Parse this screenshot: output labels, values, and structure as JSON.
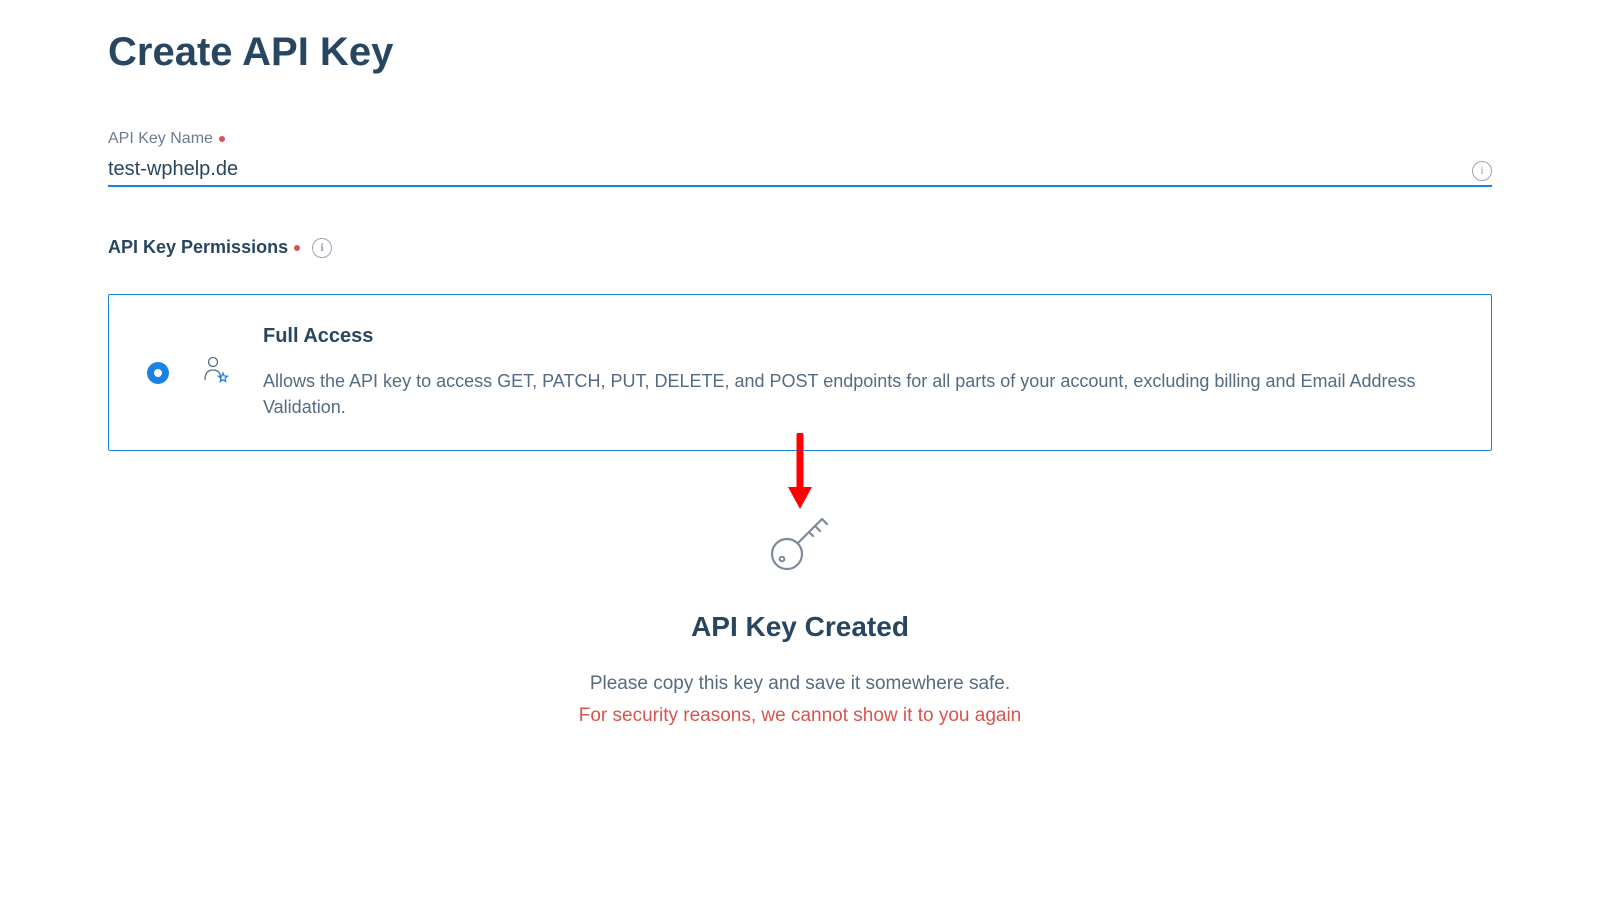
{
  "page": {
    "title": "Create API Key"
  },
  "form": {
    "name": {
      "label": "API Key Name",
      "value": "test-wphelp.de"
    },
    "permissions": {
      "label": "API Key Permissions",
      "options": [
        {
          "title": "Full Access",
          "description": "Allows the API key to access GET, PATCH, PUT, DELETE, and POST endpoints for all parts of your account, excluding billing and Email Address Validation."
        }
      ]
    }
  },
  "result": {
    "title": "API Key Created",
    "subtitle": "Please copy this key and save it somewhere safe.",
    "warning": "For security reasons, we cannot show it to you again"
  }
}
